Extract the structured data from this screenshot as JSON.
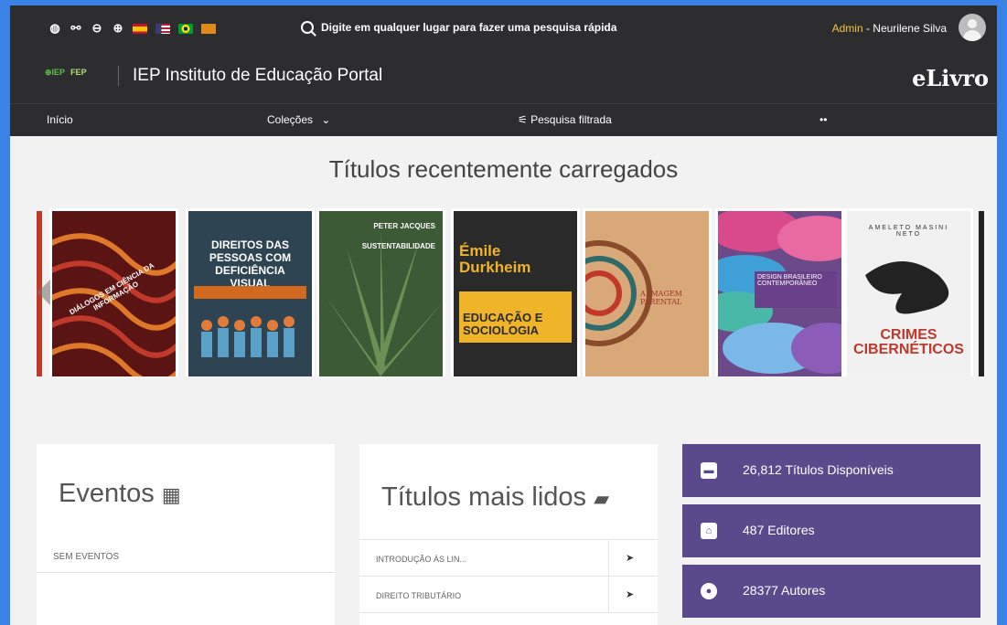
{
  "topbar": {
    "icons": [
      "globe-icon",
      "link-icon",
      "zoom-out-icon",
      "zoom-in-icon"
    ],
    "flags": [
      {
        "name": "spain-flag-icon",
        "color": "#c8102e"
      },
      {
        "name": "usa-flag-icon",
        "color": "#3c3b6e"
      },
      {
        "name": "brazil-flag-icon",
        "color": "#009c3b"
      },
      {
        "name": "flag-orange-icon",
        "color": "#e08a1e"
      }
    ],
    "search_placeholder": "Digite em qualquer lugar para fazer uma pesquisa rápida",
    "user_role": "Admin",
    "user_name": " - Neurilene Silva"
  },
  "brand": {
    "logo_iep": "⊕IEP",
    "logo_fep": "FEP",
    "title": "IEP Instituto de Educação Portal",
    "product": "eLivro"
  },
  "nav": {
    "home": "Início",
    "collections": "Coleções",
    "collections_chevron": "⌄",
    "filtered_search": "⚟ Pesquisa filtrada",
    "more": "••"
  },
  "recent": {
    "title": "Títulos recentemente carregados",
    "books": [
      {
        "title": "DIÁLOGOS EM CIÊNCIA DA INFORMAÇÃO",
        "bg": "#6a1a1a"
      },
      {
        "title": "DIREITOS DAS PESSOAS COM DEFICIÊNCIA VISUAL",
        "bg": "#2f4452"
      },
      {
        "title": "SUSTENTABILIDADE",
        "author": "PETER JACQUES",
        "bg": "#3f5f3a"
      },
      {
        "title": "EDUCAÇÃO E SOCIOLOGIA",
        "author": "Émile Durkheim",
        "bg": "#2a2a2a"
      },
      {
        "title": "A IMAGEM PARENTAL",
        "bg": "#d8a97a"
      },
      {
        "title": "DESIGN BRASILEIRO CONTEMPORÂNEO",
        "bg": "#6c4a8a"
      },
      {
        "title": "CRIMES CIBERNÉTICOS",
        "author": "AMELETO MASINI NETO",
        "bg": "#f1f1f1"
      }
    ]
  },
  "events": {
    "title": "Eventos",
    "empty": "SEM EVENTOS"
  },
  "most_read": {
    "title": "Títulos mais lidos",
    "items": [
      {
        "label": "INTRODUÇÃO ÀS LIN..."
      },
      {
        "label": "DIREITO TRIBUTÁRIO"
      }
    ]
  },
  "stats": [
    {
      "label": "26,812 Títulos Disponíveis",
      "icon": "book-icon"
    },
    {
      "label": "487 Editores",
      "icon": "bank-icon"
    },
    {
      "label": "28377 Autores",
      "icon": "user-circle-icon"
    }
  ],
  "colors": {
    "accent": "#5b4a8b",
    "background": "#3b82e6",
    "dark": "#2d2d2f",
    "admin": "#f4c542"
  }
}
